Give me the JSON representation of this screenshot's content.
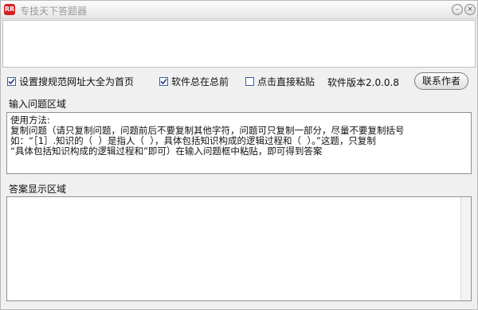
{
  "window": {
    "icon_text": "RR",
    "title": "专技天下答题器"
  },
  "toolbar": {
    "option_homepage": {
      "label": "设置搜规范网址大全为首页",
      "checked": true
    },
    "option_topmost": {
      "label": "软件总在总前",
      "checked": true
    },
    "option_paste": {
      "label": "点击直接粘贴",
      "checked": false
    },
    "version_text": "软件版本2.0.0.8",
    "contact_label": "联系作者"
  },
  "input_section": {
    "label": "输入问题区域",
    "lines": [
      "使用方法:",
      "",
      "复制问题（请只复制问题，问题前后不要复制其他字符，问题可只复制一部分，尽量不要复制括号",
      "如：“［1］.知识的（  ）是指人（  ），具体包括知识构成的逻辑过程和（  ）。”这题，只复制",
      "“具体包括知识构成的逻辑过程和”即可）在输入问题框中粘贴，即可得到答案"
    ]
  },
  "answer_section": {
    "label": "答案显示区域",
    "content": ""
  },
  "colors": {
    "accent": "#3b5ea3",
    "icon_red": "#d32020"
  }
}
